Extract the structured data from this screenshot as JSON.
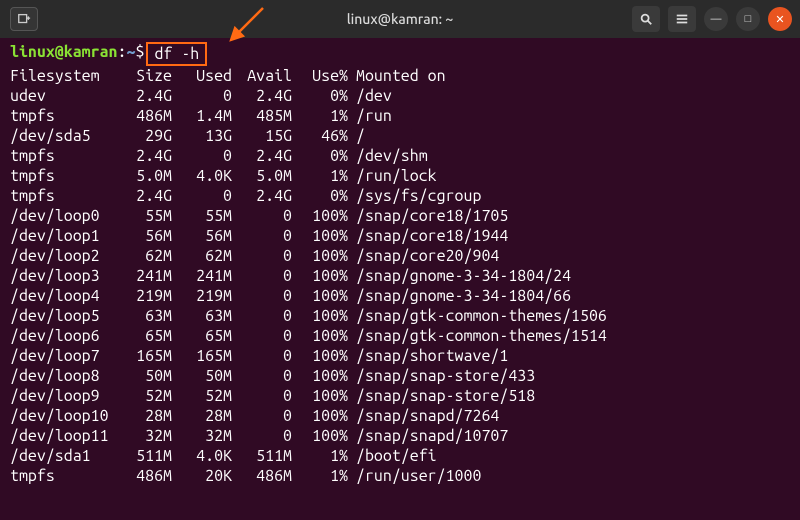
{
  "window": {
    "title": "linux@kamran: ~"
  },
  "prompt": {
    "user_host": "linux@kamran",
    "path": "~",
    "symbol": "$",
    "command": "df -h"
  },
  "header": {
    "fs": "Filesystem",
    "size": "Size",
    "used": "Used",
    "avail": "Avail",
    "usep": "Use%",
    "mnt": "Mounted on"
  },
  "rows": [
    {
      "fs": "udev",
      "size": "2.4G",
      "used": "0",
      "avail": "2.4G",
      "usep": "0%",
      "mnt": "/dev"
    },
    {
      "fs": "tmpfs",
      "size": "486M",
      "used": "1.4M",
      "avail": "485M",
      "usep": "1%",
      "mnt": "/run"
    },
    {
      "fs": "/dev/sda5",
      "size": "29G",
      "used": "13G",
      "avail": "15G",
      "usep": "46%",
      "mnt": "/"
    },
    {
      "fs": "tmpfs",
      "size": "2.4G",
      "used": "0",
      "avail": "2.4G",
      "usep": "0%",
      "mnt": "/dev/shm"
    },
    {
      "fs": "tmpfs",
      "size": "5.0M",
      "used": "4.0K",
      "avail": "5.0M",
      "usep": "1%",
      "mnt": "/run/lock"
    },
    {
      "fs": "tmpfs",
      "size": "2.4G",
      "used": "0",
      "avail": "2.4G",
      "usep": "0%",
      "mnt": "/sys/fs/cgroup"
    },
    {
      "fs": "/dev/loop0",
      "size": "55M",
      "used": "55M",
      "avail": "0",
      "usep": "100%",
      "mnt": "/snap/core18/1705"
    },
    {
      "fs": "/dev/loop1",
      "size": "56M",
      "used": "56M",
      "avail": "0",
      "usep": "100%",
      "mnt": "/snap/core18/1944"
    },
    {
      "fs": "/dev/loop2",
      "size": "62M",
      "used": "62M",
      "avail": "0",
      "usep": "100%",
      "mnt": "/snap/core20/904"
    },
    {
      "fs": "/dev/loop3",
      "size": "241M",
      "used": "241M",
      "avail": "0",
      "usep": "100%",
      "mnt": "/snap/gnome-3-34-1804/24"
    },
    {
      "fs": "/dev/loop4",
      "size": "219M",
      "used": "219M",
      "avail": "0",
      "usep": "100%",
      "mnt": "/snap/gnome-3-34-1804/66"
    },
    {
      "fs": "/dev/loop5",
      "size": "63M",
      "used": "63M",
      "avail": "0",
      "usep": "100%",
      "mnt": "/snap/gtk-common-themes/1506"
    },
    {
      "fs": "/dev/loop6",
      "size": "65M",
      "used": "65M",
      "avail": "0",
      "usep": "100%",
      "mnt": "/snap/gtk-common-themes/1514"
    },
    {
      "fs": "/dev/loop7",
      "size": "165M",
      "used": "165M",
      "avail": "0",
      "usep": "100%",
      "mnt": "/snap/shortwave/1"
    },
    {
      "fs": "/dev/loop8",
      "size": "50M",
      "used": "50M",
      "avail": "0",
      "usep": "100%",
      "mnt": "/snap/snap-store/433"
    },
    {
      "fs": "/dev/loop9",
      "size": "52M",
      "used": "52M",
      "avail": "0",
      "usep": "100%",
      "mnt": "/snap/snap-store/518"
    },
    {
      "fs": "/dev/loop10",
      "size": "28M",
      "used": "28M",
      "avail": "0",
      "usep": "100%",
      "mnt": "/snap/snapd/7264"
    },
    {
      "fs": "/dev/loop11",
      "size": "32M",
      "used": "32M",
      "avail": "0",
      "usep": "100%",
      "mnt": "/snap/snapd/10707"
    },
    {
      "fs": "/dev/sda1",
      "size": "511M",
      "used": "4.0K",
      "avail": "511M",
      "usep": "1%",
      "mnt": "/boot/efi"
    },
    {
      "fs": "tmpfs",
      "size": "486M",
      "used": "20K",
      "avail": "486M",
      "usep": "1%",
      "mnt": "/run/user/1000"
    }
  ],
  "icons": {
    "new_tab": "new-tab-icon",
    "search": "search-icon",
    "menu": "hamburger-icon",
    "minimize": "minimize-icon",
    "maximize": "maximize-icon",
    "close": "close-icon"
  },
  "colors": {
    "accent": "#e95420",
    "highlight_border": "#ff6a13",
    "terminal_bg": "#300a24",
    "prompt_user": "#8ae234",
    "prompt_path": "#729fcf"
  }
}
